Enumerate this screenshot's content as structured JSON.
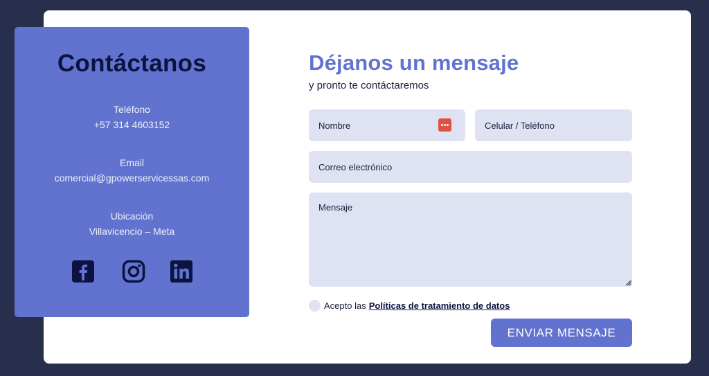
{
  "contact": {
    "title": "Contáctanos",
    "phone": {
      "label": "Teléfono",
      "value": "+57 314 4603152"
    },
    "email": {
      "label": "Email",
      "value": "comercial@gpowerservicessas.com"
    },
    "location": {
      "label": "Ubicación",
      "value": "Villavicencio – Meta"
    },
    "social": [
      "facebook-icon",
      "instagram-icon",
      "linkedin-icon"
    ]
  },
  "form": {
    "title": "Déjanos un mensaje",
    "subtitle": "y pronto te contáctaremos",
    "name_placeholder": "Nombre",
    "phone_placeholder": "Celular / Teléfono",
    "email_placeholder": "Correo electrónico",
    "message_placeholder": "Mensaje",
    "consent_text": "Acepto las",
    "consent_link": "Políticas de tratamiento de datos",
    "submit_label": "ENVIAR MENSAJE"
  },
  "colors": {
    "background": "#272f4c",
    "card": "#ffffff",
    "accent": "#6173cf",
    "field": "#dfe2f3",
    "dark_text": "#0d1340",
    "password_manager_icon": "#e05141"
  }
}
